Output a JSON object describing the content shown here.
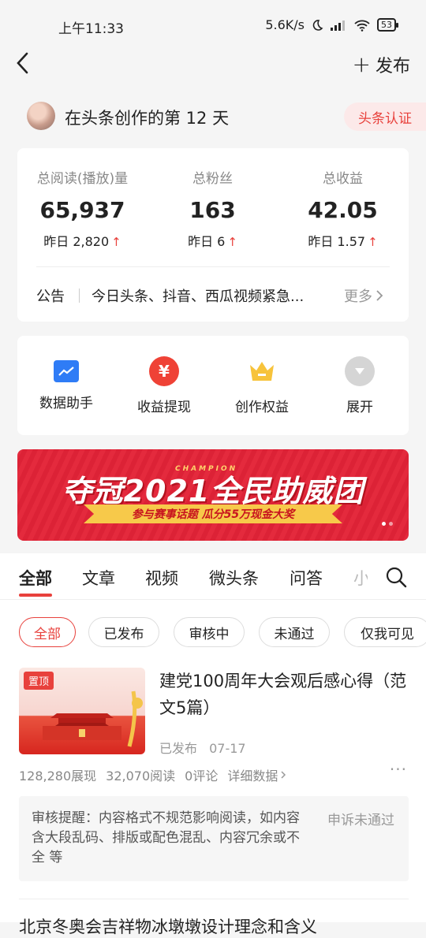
{
  "status_bar": {
    "time": "上午11:33",
    "net_speed": "5.6K/s",
    "battery": "53"
  },
  "header": {
    "publish_label": "发布"
  },
  "creator": {
    "days_text": "在头条创作的第 12 天",
    "cert_label": "头条认证"
  },
  "stats": [
    {
      "label": "总阅读(播放)量",
      "value": "65,937",
      "yesterday": "昨日 2,820"
    },
    {
      "label": "总粉丝",
      "value": "163",
      "yesterday": "昨日 6"
    },
    {
      "label": "总收益",
      "value": "42.05",
      "yesterday": "昨日 1.57"
    }
  ],
  "notice": {
    "label": "公告",
    "text": "今日头条、抖音、西瓜视频紧急...",
    "more": "更多"
  },
  "tools": [
    {
      "label": "数据助手",
      "icon": "chart-icon",
      "color": "#2f7cf6"
    },
    {
      "label": "收益提现",
      "icon": "yen-icon",
      "color": "#ef4236"
    },
    {
      "label": "创作权益",
      "icon": "crown-icon",
      "color": "#f7c33b"
    },
    {
      "label": "展开",
      "icon": "expand-icon",
      "color": "#d5d5d5"
    }
  ],
  "banner": {
    "title": "夺冠2021全民助威团",
    "champion": "CHAMPION",
    "subtitle": "参与赛事话题 瓜分55万现金大奖"
  },
  "tabs": [
    "全部",
    "文章",
    "视频",
    "微头条",
    "问答",
    "小"
  ],
  "filters": [
    "全部",
    "已发布",
    "审核中",
    "未通过",
    "仅我可见"
  ],
  "article": {
    "pin_label": "置顶",
    "title": "建党100周年大会观后感心得（范文5篇）",
    "status": "已发布",
    "date": "07-17",
    "impressions": "128,280展现",
    "reads": "32,070阅读",
    "comments": "0评论",
    "details": "详细数据",
    "review_text": "审核提醒：内容格式不规范影响阅读，如内容含大段乱码、排版或配色混乱、内容冗余或不全 等",
    "appeal_label": "申诉未通过"
  },
  "next_article": {
    "title": "北京冬奥会吉祥物冰墩墩设计理念和含义"
  }
}
